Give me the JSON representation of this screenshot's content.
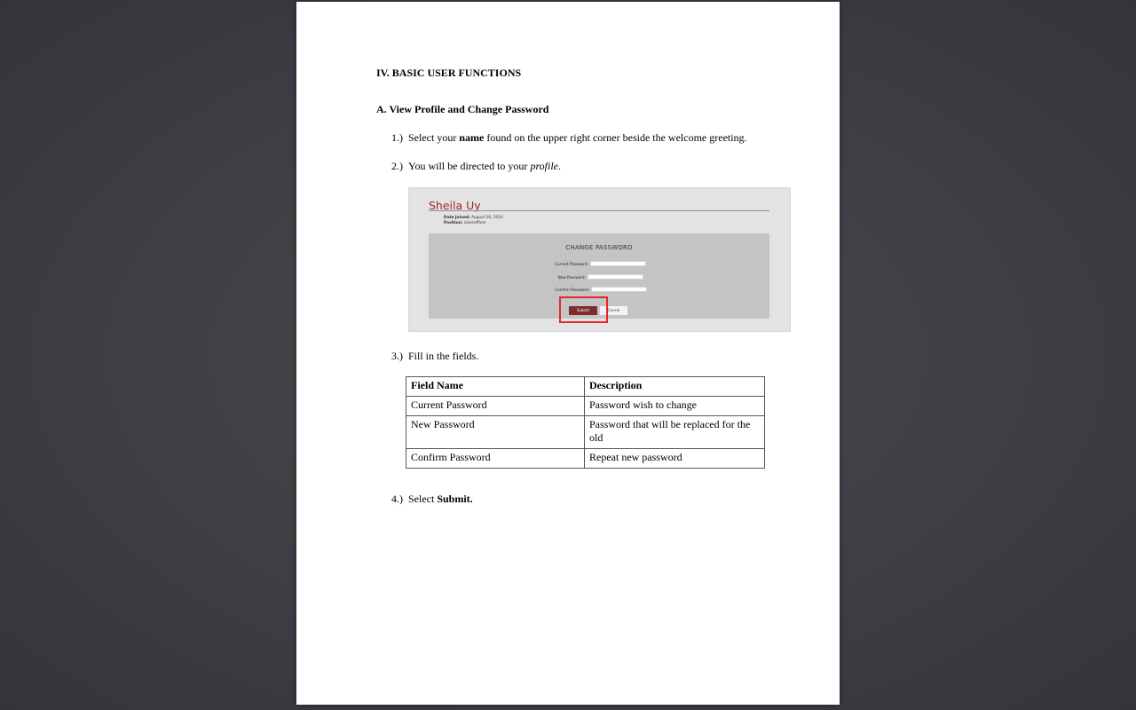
{
  "document": {
    "section_title": "IV.  BASIC USER FUNCTIONS",
    "subsection_title": "A. View Profile and Change Password",
    "steps": [
      {
        "num": "1.)",
        "pre": "Select your ",
        "em": "name",
        "post": " found on the upper right corner beside the welcome greeting."
      },
      {
        "num": "2.)",
        "pre": "You will be directed to your ",
        "em": "profile",
        "post": "."
      },
      {
        "num": "3.)",
        "pre": "Fill in the fields.",
        "em": "",
        "post": ""
      },
      {
        "num": "4.)",
        "pre": "Select ",
        "em": "Submit.",
        "post": ""
      }
    ],
    "screenshot": {
      "name": "Sheila Uy",
      "date_joined_label": "Date Joined:",
      "date_joined_value": "August 29, 2010",
      "position_label": "Position:",
      "position_value": "salveofficer",
      "panel_title": "CHANGE PASSWORD",
      "current_password_label": "Current Password:",
      "new_password_label": "New Password:",
      "confirm_password_label": "Confirm Password:",
      "submit_label": "Submit",
      "cancel_label": "Cancel"
    },
    "table": {
      "headers": [
        "Field Name",
        "Description"
      ],
      "rows": [
        [
          "Current Password",
          "Password wish to change"
        ],
        [
          "New Password",
          "Password that will be replaced for the old"
        ],
        [
          "Confirm Password",
          "Repeat new password"
        ]
      ]
    }
  }
}
